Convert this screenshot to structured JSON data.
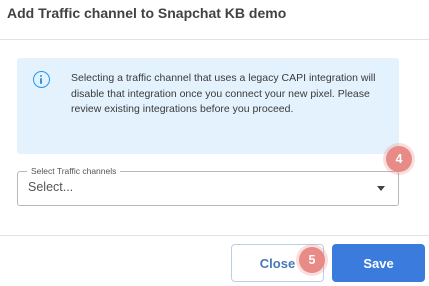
{
  "dialog": {
    "title": "Add Traffic channel to Snapchat KB demo",
    "info": {
      "icon": "info-icon",
      "text": "Selecting a traffic channel that uses a legacy CAPI integration will disable that integration once you connect your new pixel. Please review existing integrations before you proceed."
    },
    "select": {
      "label": "Select Traffic channels",
      "value": "Select..."
    },
    "badges": {
      "four": "4",
      "five": "5"
    },
    "buttons": {
      "close": "Close",
      "save": "Save"
    }
  },
  "colors": {
    "accent": "#3a7bdd",
    "info_background": "#e3f2fd",
    "info_icon": "#2196f3",
    "badge": "#e88a85"
  }
}
